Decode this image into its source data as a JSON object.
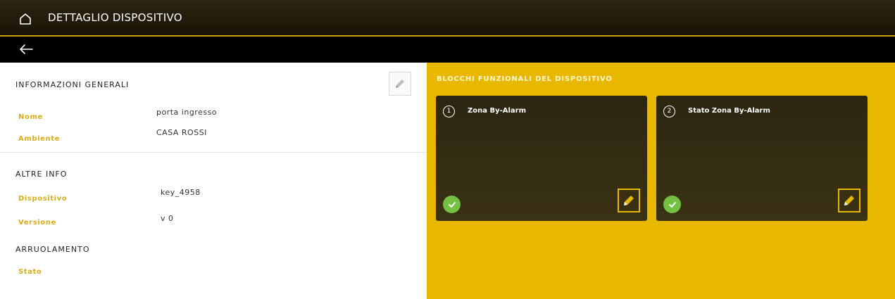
{
  "header": {
    "title": "DETTAGLIO DISPOSITIVO",
    "icon": "home-icon"
  },
  "nav": {
    "back_icon": "arrow-left-icon"
  },
  "general": {
    "title": "INFORMAZIONI GENERALI",
    "name_label": "Nome",
    "name_value": "porta ingresso",
    "room_label": "Ambiente",
    "room_value": "CASA ROSSI",
    "edit_icon": "pencil-icon"
  },
  "other_info": {
    "title": "ALTRE INFO",
    "device_label": "Dispositivo",
    "device_value": "key_4958",
    "version_label": "Versione",
    "version_value": "v 0"
  },
  "enrollment": {
    "title": "ARRUOLAMENTO",
    "status_label": "Stato"
  },
  "blocks": {
    "title": "BLOCCHI FUNZIONALI DEL DISPOSITIVO",
    "items": [
      {
        "number": "1",
        "name": "Zona By-Alarm",
        "status_icon": "check-circle-icon",
        "edit_icon": "pencil-icon"
      },
      {
        "number": "2",
        "name": "Stato Zona By-Alarm",
        "status_icon": "check-circle-icon",
        "edit_icon": "pencil-icon"
      }
    ]
  },
  "colors": {
    "accent": "#e8b800",
    "header_bg": "#2b2410",
    "label": "#d6ad1a",
    "status_ok": "#73c043",
    "card_bg": "#2c2511"
  }
}
